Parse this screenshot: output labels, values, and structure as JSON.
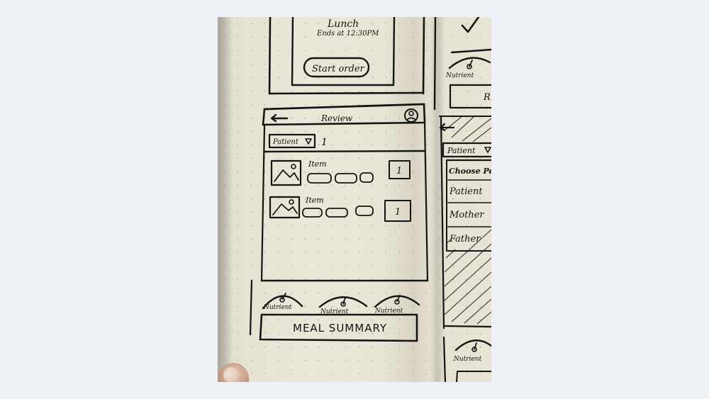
{
  "top_card": {
    "title": "Lunch",
    "subtitle": "Ends at 12:30PM",
    "button": "Start order"
  },
  "review_screen": {
    "back_arrow": "arrow-left-icon",
    "title": "Review",
    "profile_icon": "user-circle-icon",
    "person_dropdown": "Patient",
    "count": "1",
    "items": [
      {
        "label": "Item",
        "quantity": "1",
        "image_icon": "image-placeholder-icon"
      },
      {
        "label": "Item",
        "quantity": "1",
        "image_icon": "image-placeholder-icon"
      }
    ],
    "gauges": [
      {
        "label": "Nutrient"
      },
      {
        "label": "Nutrient"
      },
      {
        "label": "Nutrient"
      }
    ],
    "summary_button": "MEAL SUMMARY"
  },
  "right_page": {
    "gauge_label_top": "Nutrient",
    "button_fragment": "R",
    "dropdown": "Patient",
    "menu": [
      "Choose Pers",
      "Patient",
      "Mother",
      "Father"
    ],
    "gauge_label_bottom": "Nutrient"
  },
  "colors": {
    "paper": "#e9e5d6",
    "ink": "#141414",
    "background": "#eef2f6"
  }
}
